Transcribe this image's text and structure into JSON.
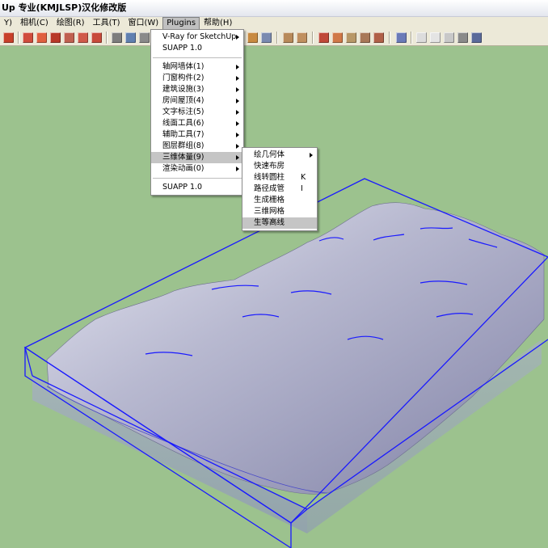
{
  "title_bar": {
    "text": "Up 专业(KMJLSP)汉化修改版"
  },
  "menubar": {
    "items": [
      "Y)",
      "相机(C)",
      "绘图(R)",
      "工具(T)",
      "窗口(W)",
      "Plugins",
      "帮助(H)"
    ]
  },
  "plugins_menu": {
    "items": [
      {
        "label": "V-Ray for SketchUp",
        "submenu": true
      },
      {
        "label": "SUAPP 1.0",
        "submenu": false
      },
      {
        "label": "轴网墙体(1)",
        "submenu": true
      },
      {
        "label": "门窗构件(2)",
        "submenu": true
      },
      {
        "label": "建筑设施(3)",
        "submenu": true
      },
      {
        "label": "房间屋顶(4)",
        "submenu": true
      },
      {
        "label": "文字标注(5)",
        "submenu": true
      },
      {
        "label": "线面工具(6)",
        "submenu": true
      },
      {
        "label": "辅助工具(7)",
        "submenu": true
      },
      {
        "label": "图层群组(8)",
        "submenu": true
      },
      {
        "label": "三维体量(9)",
        "submenu": true
      },
      {
        "label": "渲染动画(0)",
        "submenu": true
      },
      {
        "label": "SUAPP 1.0",
        "submenu": false
      }
    ]
  },
  "submenu_3d": {
    "items": [
      {
        "label": "绘几何体",
        "submenu": true,
        "shortcut": ""
      },
      {
        "label": "快速布房",
        "submenu": false,
        "shortcut": ""
      },
      {
        "label": "线转圆柱",
        "submenu": false,
        "shortcut": "K"
      },
      {
        "label": "路径成管",
        "submenu": false,
        "shortcut": "I"
      },
      {
        "label": "生成栅格",
        "submenu": false,
        "shortcut": ""
      },
      {
        "label": "三维网格",
        "submenu": false,
        "shortcut": ""
      },
      {
        "label": "生等高线",
        "submenu": false,
        "shortcut": ""
      }
    ]
  },
  "colors": {
    "background": "#9cc28e",
    "terrain": "#b8b9d0",
    "outline": "#1a1aff",
    "menu_highlight": "#c5c5c5"
  }
}
